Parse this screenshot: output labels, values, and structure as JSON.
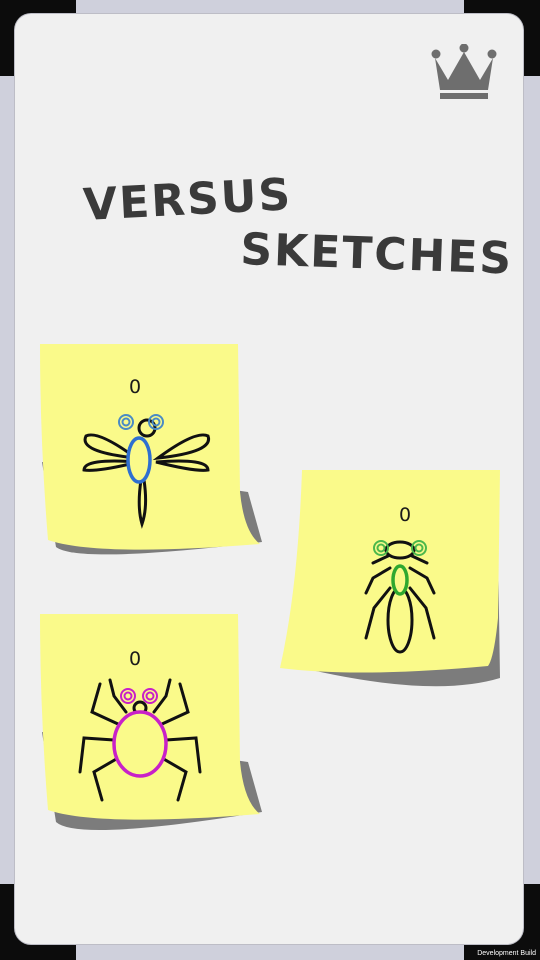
{
  "title": {
    "line1": "VERSUS",
    "line2": "SKETCHES"
  },
  "header": {
    "crown_icon": "crown-icon"
  },
  "players": [
    {
      "name": "dragonfly",
      "score": "0",
      "accent": "#2f6fd0"
    },
    {
      "name": "beetle",
      "score": "0",
      "accent": "#2fa82f"
    },
    {
      "name": "spider",
      "score": "0",
      "accent": "#c820c8"
    }
  ],
  "colors": {
    "note": "#fafa8a",
    "note_shadow": "#7c7c7c",
    "card": "#f0f0f0",
    "frame": "#cfd0dc",
    "ink": "#111111"
  },
  "footer": {
    "build_label": "Development Build"
  }
}
